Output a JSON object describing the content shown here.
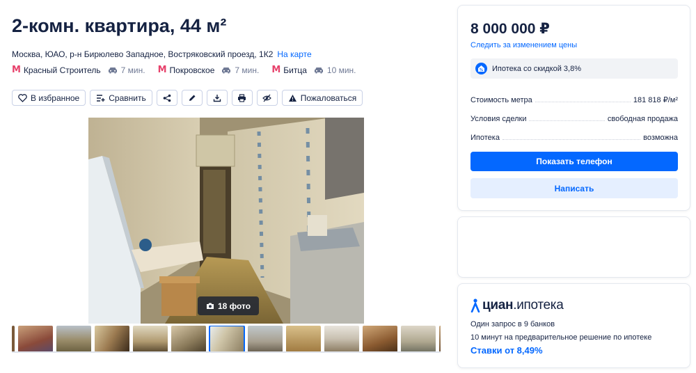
{
  "listing": {
    "title": "2-комн. квартира, 44 м²",
    "address": "Москва, ЮАО, р-н Бирюлево Западное, Востряковский проезд, 1К2",
    "map_link": "На карте",
    "metro": [
      {
        "name": "Красный Строитель",
        "time": "7 мин."
      },
      {
        "name": "Покровское",
        "time": "7 мин."
      },
      {
        "name": "Битца",
        "time": "10 мин."
      }
    ],
    "metro_color": "#e7416b"
  },
  "actions": {
    "favorite": "В избранное",
    "compare": "Сравнить",
    "complain": "Пожаловаться"
  },
  "gallery": {
    "photo_count_label": "18 фото",
    "active_thumb_index": 5
  },
  "price_card": {
    "price": "8 000 000 ₽",
    "follow_link": "Следить за изменением цены",
    "promo": "Ипотека со скидкой 3,8%",
    "rows": [
      {
        "key": "Стоимость метра",
        "value": "181 818 ₽/м²"
      },
      {
        "key": "Условия сделки",
        "value": "свободная продажа"
      },
      {
        "key": "Ипотека",
        "value": "возможна"
      }
    ],
    "show_phone": "Показать телефон",
    "write": "Написать"
  },
  "ipoteka_card": {
    "brand": "циан",
    "brand_sub": ".ипотека",
    "line1": "Один запрос в 9 банков",
    "line2": "10 минут на предварительное решение по ипотеке",
    "rate": "Ставки от 8,49%"
  },
  "colors": {
    "accent": "#0468ff",
    "text": "#152242"
  }
}
